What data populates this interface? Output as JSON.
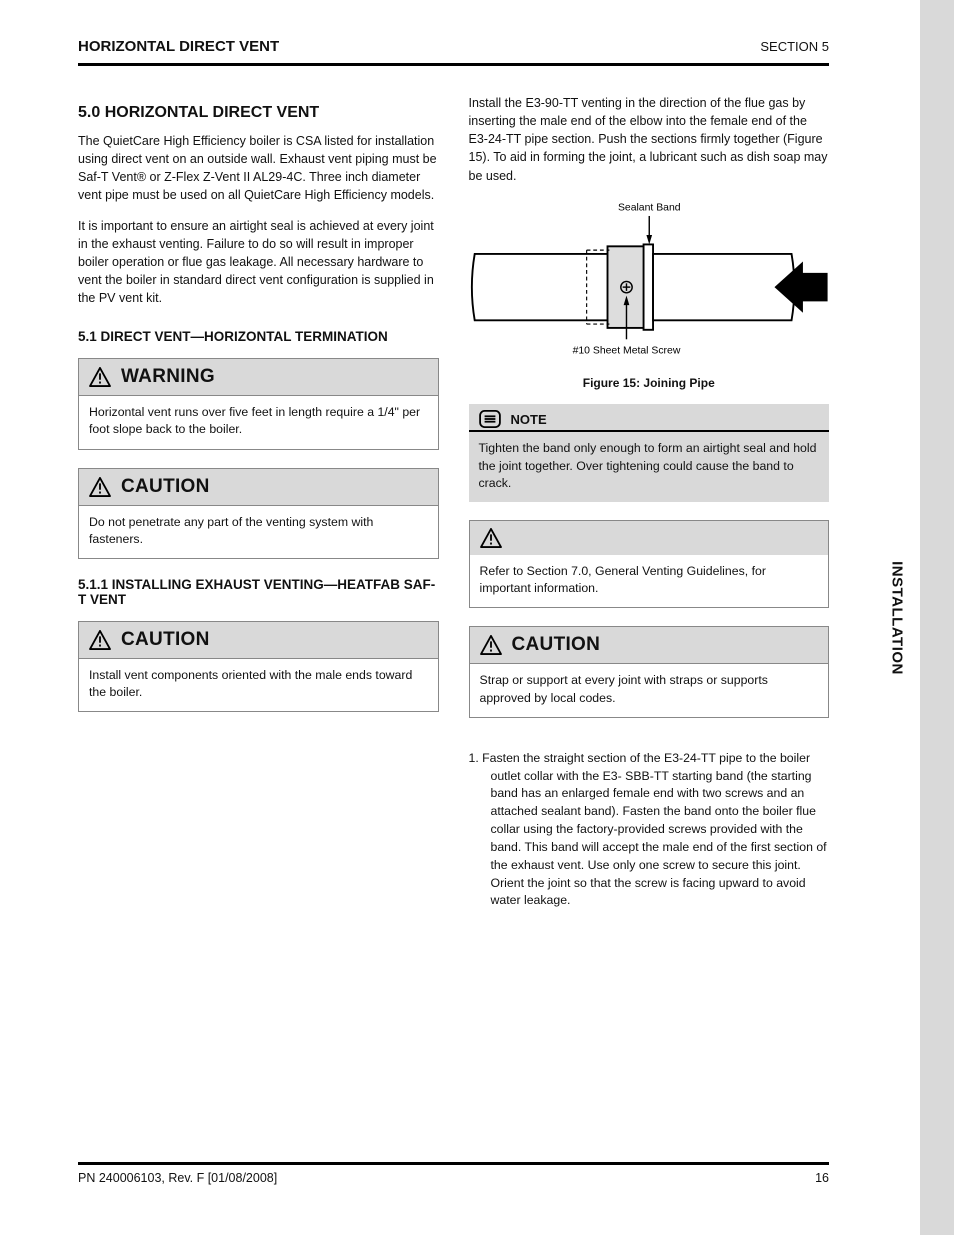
{
  "header": {
    "title": "HORIZONTAL DIRECT VENT",
    "subtitle": "SECTION 5"
  },
  "sidebar_tab": "INSTALLATION",
  "left": {
    "h1": "5.0  HORIZONTAL DIRECT VENT",
    "p1": "The QuietCare High Efficiency boiler is CSA listed for installation using direct vent on an outside wall. Exhaust vent piping must be Saf-T Vent® or Z-Flex Z-Vent II AL29-4C. Three inch diameter vent pipe must be used on all QuietCare High Efficiency models.",
    "p2": "It is important to ensure an airtight seal is achieved at every joint in the exhaust venting. Failure to do so will result in improper boiler operation or flue gas leakage. All necessary hardware to vent the boiler in standard direct vent configuration is supplied in the PV vent kit.",
    "h2": "5.1 DIRECT VENT—HORIZONTAL TERMINATION",
    "warn1_title": "WARNING",
    "warn1_body": "Horizontal vent runs over five feet in length require a 1/4\" per foot slope back to the boiler.",
    "caution1_title": "CAUTION",
    "caution1_body": "Do not penetrate any part of the venting system with fasteners.",
    "h3": "5.1.1 INSTALLING EXHAUST VENTING—HEATFAB SAF-T VENT",
    "caution2_title": "CAUTION",
    "caution2_body": "Install vent components oriented with the male ends toward the boiler."
  },
  "right": {
    "p_top": "Install the E3-90-TT venting in the direction of the flue gas by inserting the male end of the elbow into the female end of the E3-24-TT pipe section. Push the sections firmly together (Figure 15). To aid in forming the joint, a lubricant such as dish soap may be used.",
    "fig_label_top": "Sealant Band",
    "fig_label_bot": "#10 Sheet Metal Screw",
    "fig_caption": "Figure 15: Joining Pipe",
    "note_title": "NOTE",
    "note_body": "Tighten the band only enough to form an airtight seal and hold the joint together. Over tightening could cause the band to crack.",
    "ref_body": "Refer to Section 7.0, General Venting Guidelines, for important information.",
    "caution3_title": "CAUTION",
    "caution3_body": "Strap or support at every joint with straps or supports approved by local codes.",
    "step1": "1.  Fasten the straight section of the E3-24-TT pipe to the boiler outlet collar with the E3- SBB-TT starting band (the starting band has an enlarged female end with two screws and an attached sealant band). Fasten the band onto the boiler flue collar using the factory-provided screws provided with the band. This band will accept the male end of the first section of the exhaust vent. Use only one screw to secure this joint.  Orient the joint so that the screw is facing upward to avoid water leakage."
  },
  "footer": {
    "left": "PN 240006103, Rev. F [01/08/2008]",
    "right": "16"
  }
}
